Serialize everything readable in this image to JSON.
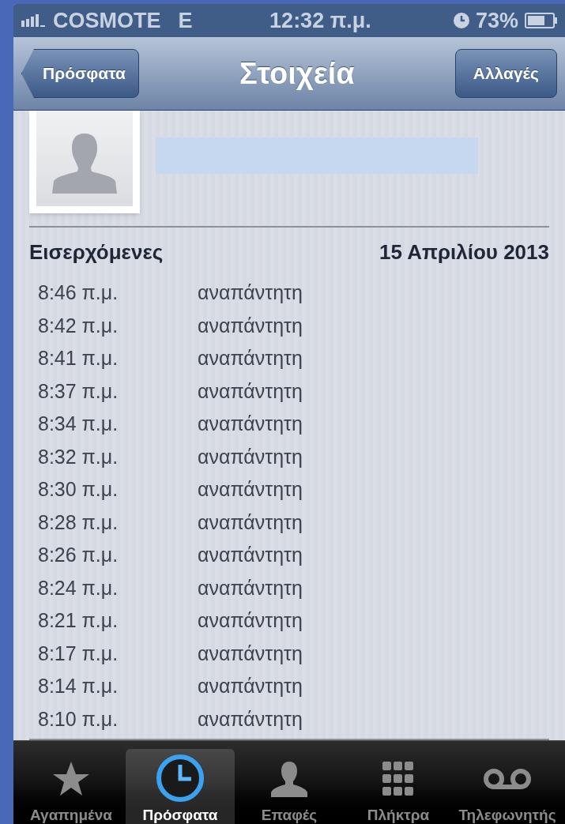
{
  "status_bar": {
    "carrier": "COSMOTE",
    "network": "E",
    "time": "12:32 π.μ.",
    "battery": "73%"
  },
  "nav_bar": {
    "back_button": "Πρόσφατα",
    "title": "Στοιχεία",
    "edit_button": "Αλλαγές"
  },
  "call_log": {
    "direction": "Εισερχόμενες",
    "date": "15 Απριλίου 2013",
    "calls": [
      {
        "time": "8:46 π.μ.",
        "status": "αναπάντητη"
      },
      {
        "time": "8:42 π.μ.",
        "status": "αναπάντητη"
      },
      {
        "time": "8:41 π.μ.",
        "status": "αναπάντητη"
      },
      {
        "time": "8:37 π.μ.",
        "status": "αναπάντητη"
      },
      {
        "time": "8:34 π.μ.",
        "status": "αναπάντητη"
      },
      {
        "time": "8:32 π.μ.",
        "status": "αναπάντητη"
      },
      {
        "time": "8:30 π.μ.",
        "status": "αναπάντητη"
      },
      {
        "time": "8:28 π.μ.",
        "status": "αναπάντητη"
      },
      {
        "time": "8:26 π.μ.",
        "status": "αναπάντητη"
      },
      {
        "time": "8:24 π.μ.",
        "status": "αναπάντητη"
      },
      {
        "time": "8:21 π.μ.",
        "status": "αναπάντητη"
      },
      {
        "time": "8:17 π.μ.",
        "status": "αναπάντητη"
      },
      {
        "time": "8:14 π.μ.",
        "status": "αναπάντητη"
      },
      {
        "time": "8:10 π.μ.",
        "status": "αναπάντητη"
      }
    ]
  },
  "tab_bar": [
    {
      "kind": "favorites",
      "label": "Αγαπημένα",
      "selected": false
    },
    {
      "kind": "recents",
      "label": "Πρόσφατα",
      "selected": true
    },
    {
      "kind": "contacts",
      "label": "Επαφές",
      "selected": false
    },
    {
      "kind": "keypad",
      "label": "Πλήκτρα",
      "selected": false
    },
    {
      "kind": "voicemail",
      "label": "Τηλεφωνητής",
      "selected": false
    }
  ]
}
